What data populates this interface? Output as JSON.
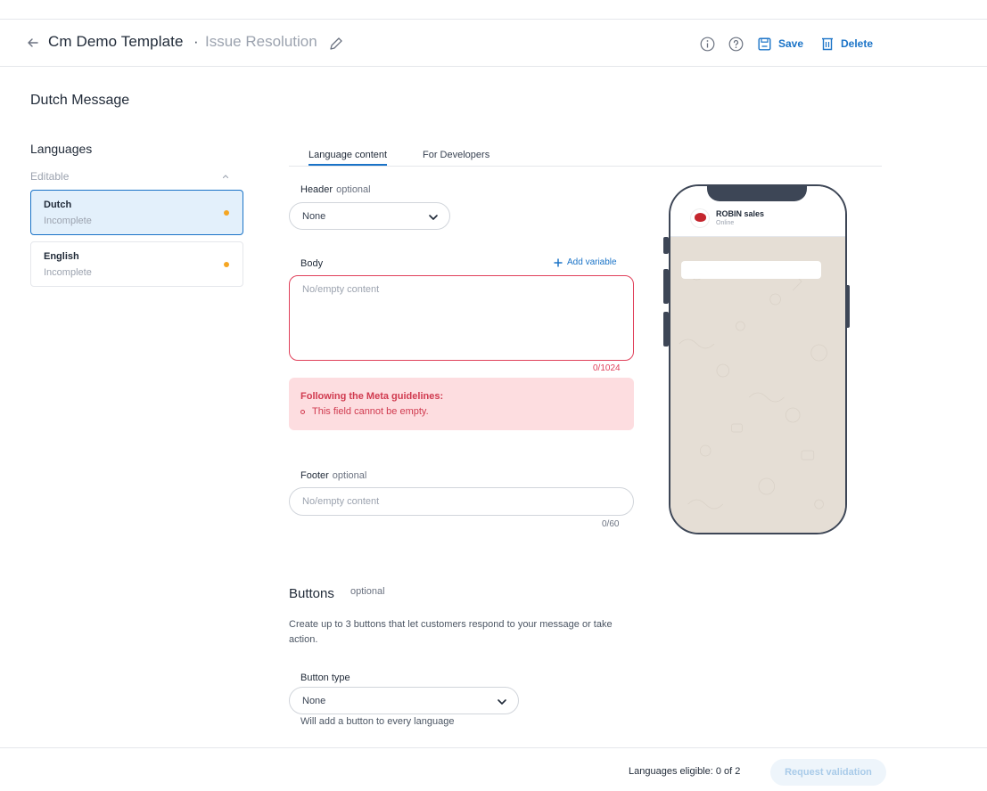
{
  "header": {
    "title": "Cm Demo Template",
    "separator": "·",
    "subtitle": "Issue Resolution",
    "save_label": "Save",
    "delete_label": "Delete"
  },
  "page": {
    "heading": "Dutch Message"
  },
  "sidebar": {
    "title": "Languages",
    "group_label": "Editable",
    "items": [
      {
        "name": "Dutch",
        "status": "Incomplete",
        "active": true
      },
      {
        "name": "English",
        "status": "Incomplete",
        "active": false
      }
    ],
    "status_dot_color": "#f5a623"
  },
  "tabs": [
    {
      "label": "Language content",
      "active": true
    },
    {
      "label": "For Developers",
      "active": false
    }
  ],
  "form": {
    "header": {
      "label": "Header",
      "optional": "optional",
      "value": "None"
    },
    "body": {
      "label": "Body",
      "add_variable": "Add variable",
      "placeholder": "No/empty content",
      "counter": "0/1024"
    },
    "guidelines": {
      "title": "Following the Meta guidelines:",
      "errors": [
        "This field cannot be empty."
      ]
    },
    "footer": {
      "label": "Footer",
      "optional": "optional",
      "placeholder": "No/empty content",
      "counter": "0/60"
    },
    "buttons": {
      "title": "Buttons",
      "optional": "optional",
      "description": "Create up to 3 buttons that let customers respond to your message or take action.",
      "type_label": "Button type",
      "type_value": "None",
      "hint": "Will add a button to every language"
    }
  },
  "preview": {
    "contact_name": "ROBIN sales",
    "contact_status": "Online"
  },
  "bottom_bar": {
    "eligible": "Languages eligible: 0 of 2",
    "request_label": "Request validation"
  },
  "colors": {
    "accent": "#1a73c7",
    "error": "#e0405a",
    "error_bg": "#fddde0"
  }
}
